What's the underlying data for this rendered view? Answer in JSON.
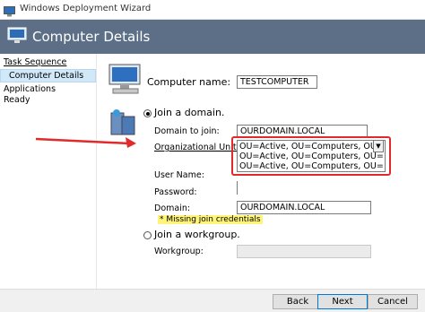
{
  "window": {
    "title": "Windows Deployment Wizard"
  },
  "header": {
    "title": "Computer Details"
  },
  "sidebar": {
    "items": [
      {
        "label": "Task Sequence"
      },
      {
        "label": "Computer Details"
      },
      {
        "label": "Applications"
      },
      {
        "label": "Ready"
      }
    ]
  },
  "form": {
    "computer_name_label": "Computer name:",
    "computer_name_value": "TESTCOMPUTER",
    "join_domain_label": "Join a domain.",
    "domain_to_join_label": "Domain to join:",
    "domain_to_join_value": "OURDOMAIN.LOCAL",
    "ou_label": "Organizational Unit:",
    "ou_options": [
      "OU=Active, OU=Computers, OU=SC, OU",
      "OU=Active, OU=Computers, OU=HP, OU",
      "OU=Active, OU=Computers, OU=SGH, OU"
    ],
    "user_name_label": "User Name:",
    "user_name_value": "",
    "password_label": "Password:",
    "password_value": "",
    "domain_label": "Domain:",
    "domain_value": "OURDOMAIN.LOCAL",
    "warning": "* Missing join credentials",
    "join_workgroup_label": "Join a workgroup.",
    "workgroup_label": "Workgroup:",
    "workgroup_value": ""
  },
  "footer": {
    "back": "Back",
    "next": "Next",
    "cancel": "Cancel"
  },
  "colors": {
    "header": "#5c6f87",
    "highlight": "#e12b2b",
    "warning_bg": "#fff47a"
  }
}
